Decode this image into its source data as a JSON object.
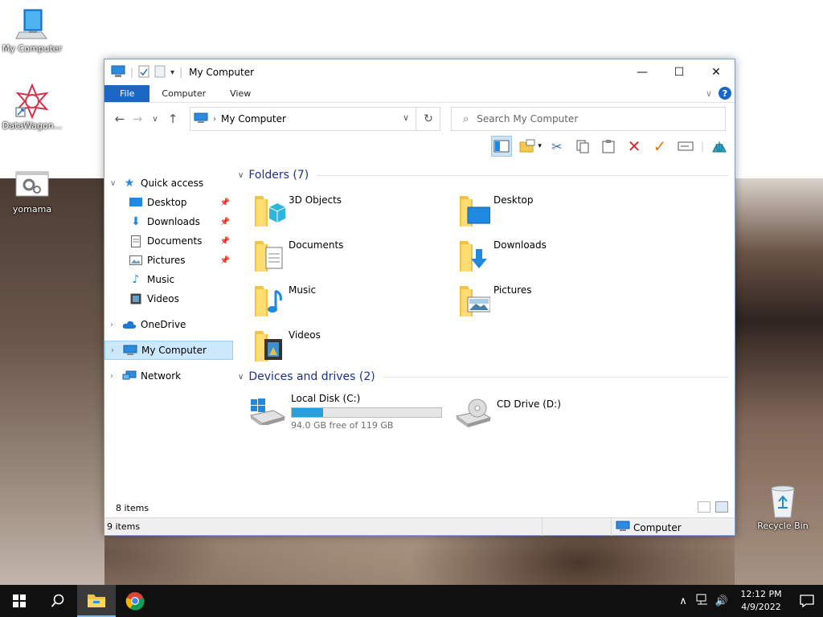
{
  "desktop": {
    "icons": [
      {
        "label": "My Computer",
        "icon": "computer-icon"
      },
      {
        "label": "DataWagon...",
        "icon": "datawagon-icon"
      },
      {
        "label": "yomama",
        "icon": "settings-file-icon"
      },
      {
        "label": "Recycle Bin",
        "icon": "recycle-bin-icon"
      }
    ]
  },
  "window": {
    "title": "My Computer",
    "tabs": {
      "file": "File",
      "computer": "Computer",
      "view": "View"
    },
    "address": "My Computer",
    "search_placeholder": "Search My Computer",
    "nav": {
      "quick_access": "Quick access",
      "quick_items": [
        {
          "label": "Desktop"
        },
        {
          "label": "Downloads"
        },
        {
          "label": "Documents"
        },
        {
          "label": "Pictures"
        },
        {
          "label": "Music"
        },
        {
          "label": "Videos"
        }
      ],
      "onedrive": "OneDrive",
      "my_computer": "My Computer",
      "network": "Network"
    },
    "folders_header": "Folders (7)",
    "folders": [
      {
        "label": "3D Objects"
      },
      {
        "label": "Desktop"
      },
      {
        "label": "Documents"
      },
      {
        "label": "Downloads"
      },
      {
        "label": "Music"
      },
      {
        "label": "Pictures"
      },
      {
        "label": "Videos"
      }
    ],
    "drives_header": "Devices and drives (2)",
    "drives": [
      {
        "name": "Local Disk (C:)",
        "free_text": "94.0 GB free of 119 GB",
        "used_fraction": 0.21
      },
      {
        "name": "CD Drive (D:)"
      }
    ],
    "inner_status": "8 items",
    "outer_status": "9 items",
    "status_location": "Computer"
  },
  "taskbar": {
    "time": "12:12 PM",
    "date": "4/9/2022"
  },
  "colors": {
    "accent": "#1a67c6",
    "header_text": "#1e3287",
    "drive_bar": "#26a0da",
    "selection": "#cce8ff"
  }
}
